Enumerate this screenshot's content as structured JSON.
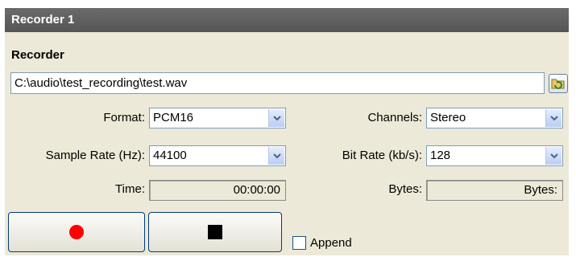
{
  "window": {
    "title": "Recorder 1"
  },
  "section": {
    "label": "Recorder"
  },
  "file": {
    "path": "C:\\audio\\test_recording\\test.wav"
  },
  "format": {
    "label": "Format:",
    "value": "PCM16"
  },
  "channels": {
    "label": "Channels:",
    "value": "Stereo"
  },
  "sample_rate": {
    "label": "Sample Rate (Hz):",
    "value": "44100"
  },
  "bit_rate": {
    "label": "Bit Rate (kb/s):",
    "value": "128"
  },
  "time": {
    "label": "Time:",
    "value": "00:00:00"
  },
  "bytes": {
    "label": "Bytes:",
    "value": "Bytes:"
  },
  "append": {
    "label": "Append",
    "checked": false
  },
  "colors": {
    "title_bar": "#5e5e5e",
    "panel_bg": "#ece9d8",
    "record_icon": "#ff0000",
    "stop_icon": "#000000",
    "dropdown_arrow": "#4d6185"
  },
  "icons": {
    "browse": "folder-refresh-icon",
    "dropdown": "chevron-down-icon",
    "record": "record-icon",
    "stop": "stop-icon"
  }
}
